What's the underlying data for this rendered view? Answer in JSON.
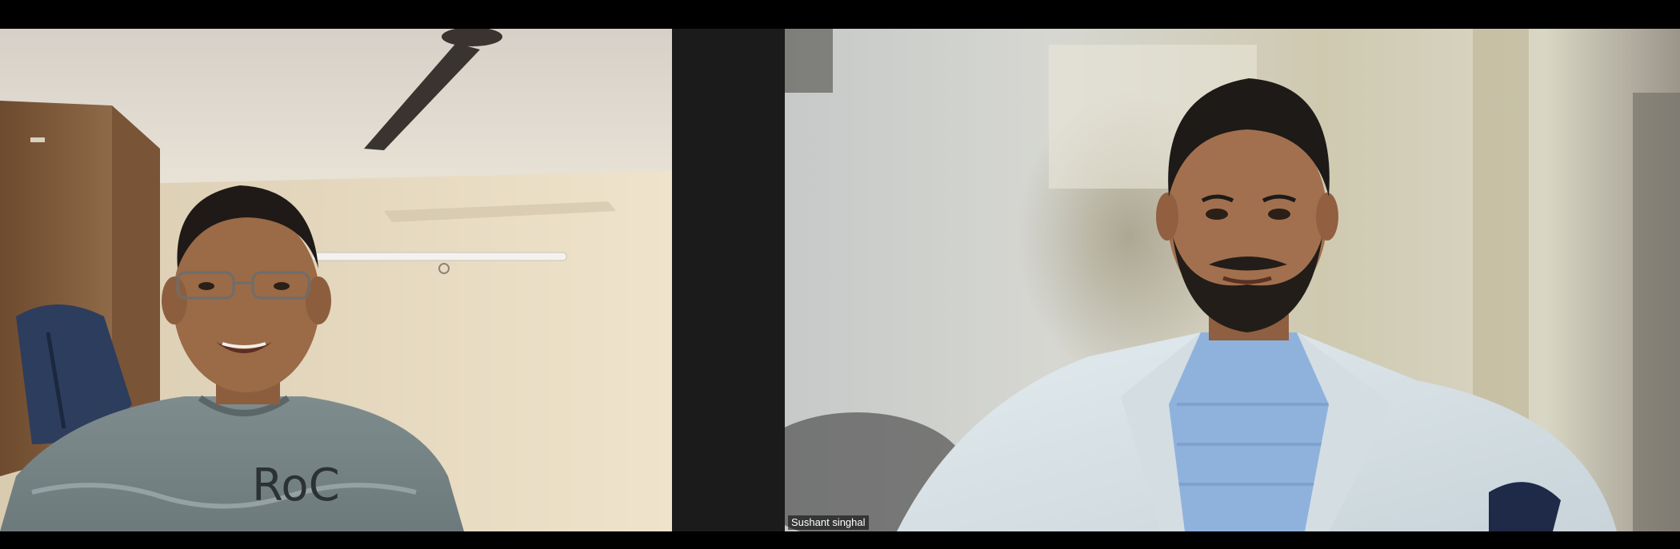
{
  "meeting": {
    "participants": [
      {
        "tile": "left",
        "name": ""
      },
      {
        "tile": "right",
        "name": "Sushant singhal"
      }
    ]
  },
  "colors": {
    "background": "#000000",
    "gap": "#1b1b1b",
    "label_text": "#ffffff"
  }
}
